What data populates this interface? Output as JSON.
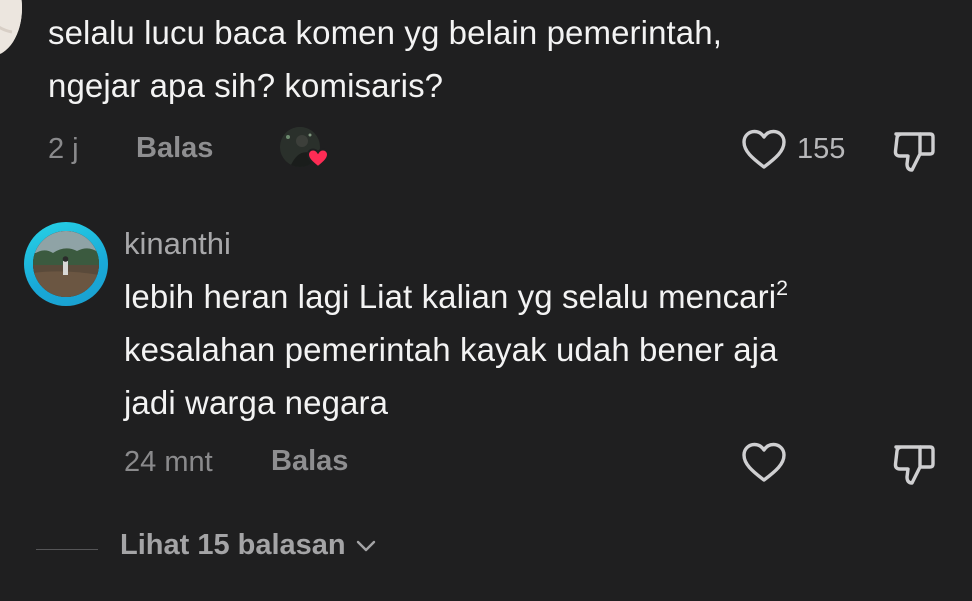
{
  "parent_comment": {
    "line1": "selalu lucu baca komen yg belain pemerintah,",
    "line2": "ngejar apa sih? komisaris?",
    "time": "2 j",
    "reply_label": "Balas",
    "like_count": "155",
    "icons": [
      "heart-outline-icon",
      "thumbs-down-icon",
      "liked-by-creator-heart-icon"
    ]
  },
  "reply": {
    "username": "kinanthi",
    "line1": "lebih heran lagi Liat kalian yg selalu mencari",
    "line1_sup": "2",
    "line2": "kesalahan pemerintah kayak udah bener aja",
    "line3": "jadi warga negara",
    "time": "24 mnt",
    "reply_label": "Balas",
    "icons": [
      "heart-outline-icon",
      "thumbs-down-icon"
    ]
  },
  "view_replies": {
    "label": "Lihat 15 balasan",
    "icon": "chevron-down-icon"
  },
  "colors": {
    "background": "#1f1f20",
    "text_primary": "#f3f3f3",
    "text_secondary": "#8a8a8c",
    "avatar_ring": "#1fb8dc",
    "creator_heart": "#fe2c55"
  }
}
